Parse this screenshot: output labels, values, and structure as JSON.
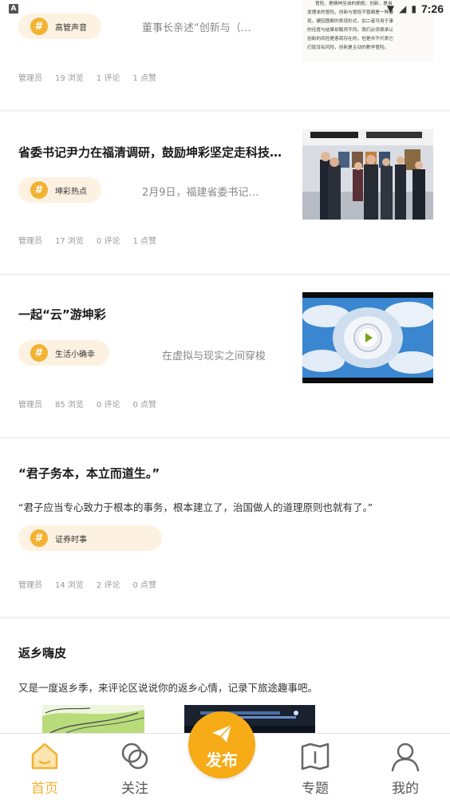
{
  "status_bar": {
    "time": "7:26",
    "app_badge": "A"
  },
  "posts": [
    {
      "title": "",
      "tag": "高管声音",
      "summary": "董事长亲述“创新与（…",
      "meta": {
        "author": "管理员",
        "views": "19 浏览",
        "comments": "1 评论",
        "likes": "1 点赞"
      },
      "thumbnail_lines": [
        "冒险，是精神至诚的拥抱；创新，是自",
        "发理本的冒险，创新与冒险不管都是一种展",
        "现，硬因图都的表现形式，加二者可用于事",
        "的径度与结果却截然不同。我们必须择承认",
        "创新的风险是客观存在的，但是并不代表它",
        "们就没有风险，创新是主动的教学冒险。"
      ]
    },
    {
      "title": "省委书记尹力在福清调研，鼓励坤彩坚定走科技…",
      "tag": "坤彩热点",
      "summary": "2月9日，福建省委书记…",
      "meta": {
        "author": "管理员",
        "views": "17 浏览",
        "comments": "0 评论",
        "likes": "1 点赞"
      }
    },
    {
      "title": "一起“云”游坤彩",
      "tag": "生活小确幸",
      "summary": "在虚拟与现实之间穿梭",
      "meta": {
        "author": "管理员",
        "views": "85 浏览",
        "comments": "0 评论",
        "likes": "0 点赞"
      }
    },
    {
      "title": "“君子务本，本立而道生。”",
      "body": "“君子应当专心致力于根本的事务，根本建立了，治国做人的道理原则也就有了。”",
      "tag": "证券时事",
      "meta": {
        "author": "管理员",
        "views": "14 浏览",
        "comments": "2 评论",
        "likes": "0 点赞"
      }
    },
    {
      "title": "返乡嗨皮",
      "body": "又是一度返乡季，来评论区说说你的返乡心情，记录下旅途趣事吧。"
    }
  ],
  "bottom_nav": {
    "items": [
      {
        "label": "首页",
        "icon": "home-icon",
        "active": true
      },
      {
        "label": "关注",
        "icon": "follow-icon",
        "active": false
      },
      {
        "label": "专题",
        "icon": "topic-book-icon",
        "active": false
      },
      {
        "label": "我的",
        "icon": "profile-icon",
        "active": false
      }
    ],
    "publish_label": "发布",
    "accent_color": "#f3b232",
    "publish_color": "#f6ab17"
  }
}
